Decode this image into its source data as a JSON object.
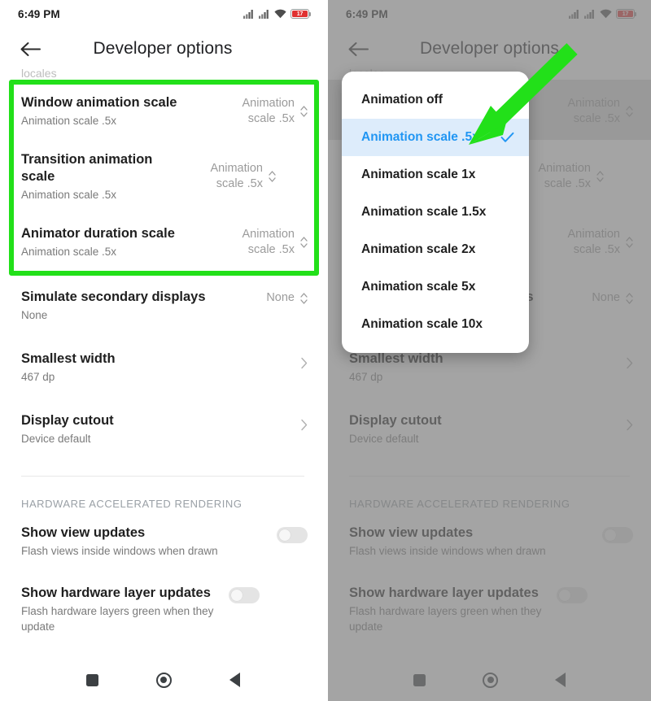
{
  "status_bar": {
    "time": "6:49 PM",
    "battery_level": "17",
    "icons": [
      "signal-bars-icon",
      "signal-bars-icon",
      "wifi-icon",
      "battery-icon"
    ]
  },
  "app_bar": {
    "back_label": "back-arrow-icon",
    "title": "Developer options"
  },
  "colors": {
    "accent_green": "#22e019",
    "selected_blue": "#2196f3",
    "selected_row_bg": "#ddecfb",
    "battery_red": "#e03131"
  },
  "partial_top_row": {
    "text": "locales"
  },
  "settings_rows": [
    {
      "title": "Window animation scale",
      "subtitle": "Animation scale .5x",
      "value": "Animation scale .5x",
      "control": "updown-icon",
      "highlighted": true
    },
    {
      "title": "Transition animation scale",
      "subtitle": "Animation scale .5x",
      "value": "Animation scale .5x",
      "control": "updown-icon",
      "highlighted": false
    },
    {
      "title": "Animator duration scale",
      "subtitle": "Animation scale .5x",
      "value": "Animation scale .5x",
      "control": "updown-icon",
      "highlighted": false
    },
    {
      "title": "Simulate secondary displays",
      "subtitle": "None",
      "value": "None",
      "control": "updown-icon",
      "highlighted": false
    },
    {
      "title": "Smallest width",
      "subtitle": "467 dp",
      "value": "",
      "control": "chevron-right-icon",
      "highlighted": false
    },
    {
      "title": "Display cutout",
      "subtitle": "Device default",
      "value": "",
      "control": "chevron-right-icon",
      "highlighted": false
    }
  ],
  "section": {
    "header": "HARDWARE ACCELERATED RENDERING",
    "rows": [
      {
        "title": "Show view updates",
        "subtitle": "Flash views inside windows when drawn",
        "control": "toggle-switch-off"
      },
      {
        "title": "Show hardware layer updates",
        "subtitle": "Flash hardware layers green when they update",
        "control": "toggle-switch-off"
      }
    ]
  },
  "dialog": {
    "options": [
      {
        "label": "Animation off",
        "selected": false
      },
      {
        "label": "Animation scale .5x",
        "selected": true
      },
      {
        "label": "Animation scale 1x",
        "selected": false
      },
      {
        "label": "Animation scale 1.5x",
        "selected": false
      },
      {
        "label": "Animation scale 2x",
        "selected": false
      },
      {
        "label": "Animation scale 5x",
        "selected": false
      },
      {
        "label": "Animation scale 10x",
        "selected": false
      }
    ],
    "check_icon": "check-icon"
  },
  "nav_bar": {
    "recents": "recents-square-icon",
    "home": "home-circle-icon",
    "back": "back-triangle-icon"
  },
  "annotations": {
    "green_box": "green-highlight-box",
    "green_arrow": "green-pointer-arrow"
  }
}
